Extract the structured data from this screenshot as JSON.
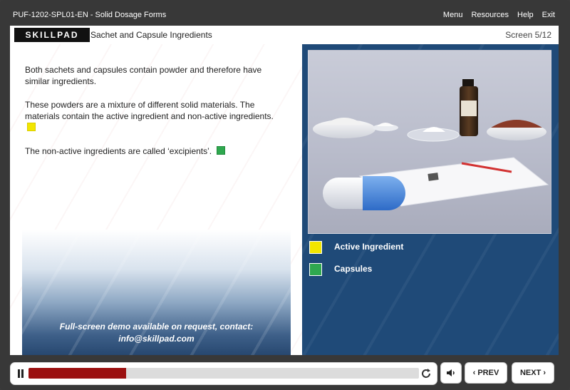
{
  "app": {
    "course_title": "PUF-1202-SPL01-EN - Solid Dosage Forms",
    "nav": [
      "Menu",
      "Resources",
      "Help",
      "Exit"
    ]
  },
  "header": {
    "logo_text": "SKILLPAD",
    "title": "Sachet and Capsule Ingredients",
    "screen_label": "Screen 5/12"
  },
  "content": {
    "paragraphs": [
      "Both sachets and capsules contain powder and therefore have similar ingredients.",
      "These powders are a mixture of different solid materials. The materials contain the active ingredient and non-active ingredients.",
      "The non-active ingredients are called ‘excipients’."
    ]
  },
  "demo_note": {
    "line1": "Full-screen demo available on request, contact:",
    "line2": "info@skillpad.com"
  },
  "legend": [
    {
      "label": "Active Ingredient",
      "color": "#f2e600"
    },
    {
      "label": "Capsules",
      "color": "#2fa84f"
    }
  ],
  "controls": {
    "progress": 0.25,
    "prev_label": "PREV",
    "next_label": "NEXT"
  },
  "colors": {
    "accent_red": "#9b1010",
    "panel_blue": "#1f4a78",
    "frame_dark": "#383838"
  }
}
